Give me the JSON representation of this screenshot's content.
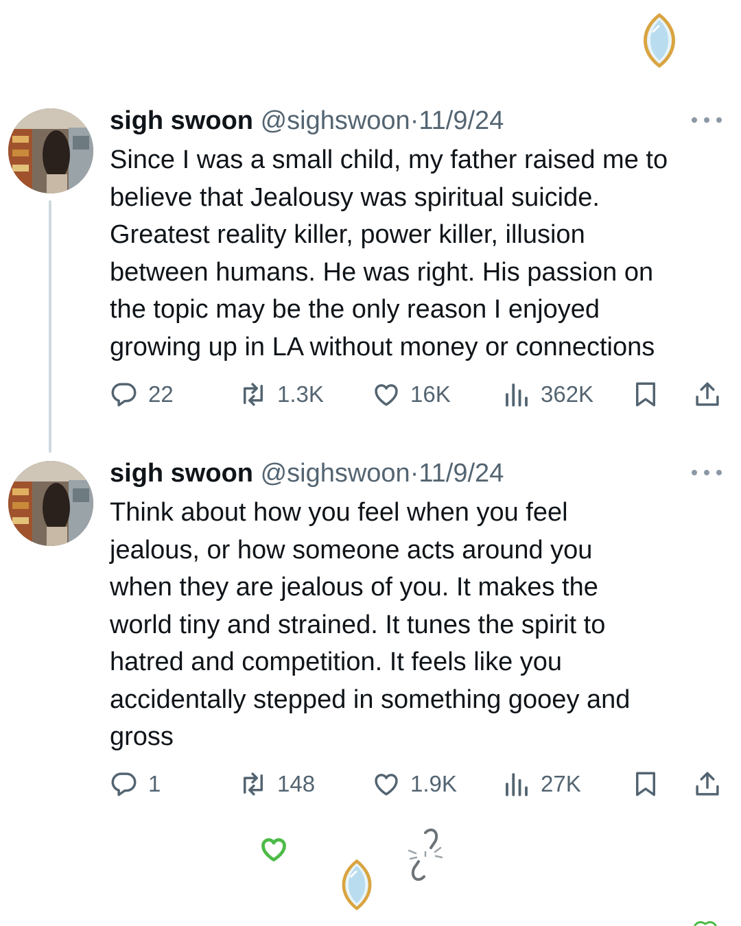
{
  "tweets": [
    {
      "name": "sigh swoon",
      "handle": "@sighswoon",
      "separator": "·",
      "date": "11/9/24",
      "text": "Since I was a small child, my father raised me to\nbelieve that Jealousy was spiritual suicide.\nGreatest reality killer, power killer, illusion\nbetween humans.  He was right.  His passion on\nthe topic may be the only reason I enjoyed\ngrowing up in LA without money or connections",
      "replies": "22",
      "retweets": "1.3K",
      "likes": "16K",
      "views": "362K"
    },
    {
      "name": "sigh swoon",
      "handle": "@sighswoon",
      "separator": "·",
      "date": "11/9/24",
      "text": "Think about how you feel when you feel\njealous, or how someone acts around you\nwhen they are jealous of you.  It makes the\nworld tiny and strained.  It tunes the spirit to\nhatred and competition. It feels like you\naccidentally stepped in something gooey and\ngross",
      "replies": "1",
      "retweets": "148",
      "likes": "1.9K",
      "views": "27K"
    }
  ],
  "icons": {
    "reply": "reply-icon",
    "retweet": "retweet-icon",
    "like": "heart-icon",
    "views": "views-icon",
    "bookmark": "bookmark-icon",
    "share": "share-icon",
    "more": "more-icon",
    "decorations": [
      "mirror-emoji",
      "green-heart-emoji",
      "broken-chain-emoji"
    ]
  },
  "colors": {
    "text": "#0f1419",
    "secondary": "#536471",
    "thread_line": "#cfd9de",
    "deco_green": "#4cbb47",
    "deco_gold": "#d9a441"
  }
}
